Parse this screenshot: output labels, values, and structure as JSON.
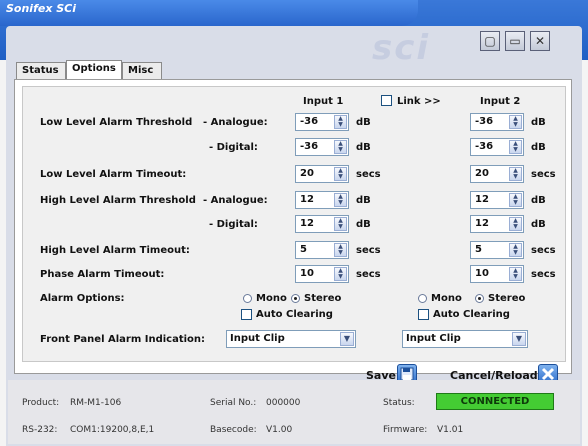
{
  "window": {
    "title": "Sonifex SCi",
    "logo_text": "sci",
    "buttons": [
      "minimize",
      "maximize",
      "close"
    ]
  },
  "tabs": [
    {
      "label": "Status",
      "active": false
    },
    {
      "label": "Options",
      "active": true
    },
    {
      "label": "Misc",
      "active": false
    }
  ],
  "headers": {
    "input1": "Input 1",
    "link_label": "Link >>",
    "link_checked": false,
    "input2": "Input 2"
  },
  "rows": {
    "low_thresh": {
      "label": "Low Level Alarm Threshold",
      "sub": "- Analogue:",
      "in1": "-36",
      "in2": "-36",
      "unit": "dB"
    },
    "low_digital": {
      "sub": "- Digital:",
      "in1": "-36",
      "in2": "-36",
      "unit": "dB"
    },
    "low_timeout": {
      "label": "Low Level Alarm Timeout:",
      "in1": "20",
      "in2": "20",
      "unit": "secs"
    },
    "high_thresh": {
      "label": "High Level Alarm Threshold",
      "sub": "- Analogue:",
      "in1": "12",
      "in2": "12",
      "unit": "dB"
    },
    "high_digital": {
      "sub": "- Digital:",
      "in1": "12",
      "in2": "12",
      "unit": "dB"
    },
    "high_timeout": {
      "label": "High Level Alarm Timeout:",
      "in1": "5",
      "in2": "5",
      "unit": "secs"
    },
    "phase_timeout": {
      "label": "Phase Alarm Timeout:",
      "in1": "10",
      "in2": "10",
      "unit": "secs"
    }
  },
  "alarm_options": {
    "label": "Alarm Options:",
    "mono": "Mono",
    "stereo": "Stereo",
    "auto_clearing": "Auto Clearing",
    "in1_selected": "Stereo",
    "in2_selected": "Stereo",
    "in1_auto": false,
    "in2_auto": false
  },
  "front_panel": {
    "label": "Front Panel Alarm Indication:",
    "in1_value": "Input Clip",
    "in2_value": "Input Clip"
  },
  "actions": {
    "save": "Save",
    "cancel": "Cancel/Reload"
  },
  "status_bar": {
    "product_label": "Product:",
    "product_value": "RM-M1-106",
    "serial_label": "Serial No.:",
    "serial_value": "000000",
    "status_label": "Status:",
    "status_value": "CONNECTED",
    "status_color": "#44cc33",
    "rs232_label": "RS-232:",
    "rs232_value": "COM1:19200,8,E,1",
    "basecode_label": "Basecode:",
    "basecode_value": "V1.00",
    "firmware_label": "Firmware:",
    "firmware_value": "V1.01"
  },
  "colors": {
    "titlebar": "#2a66cc",
    "window_body": "#d9dde8",
    "save_icon": "#3d7fd8",
    "cancel_icon": "#3d7fd8"
  }
}
